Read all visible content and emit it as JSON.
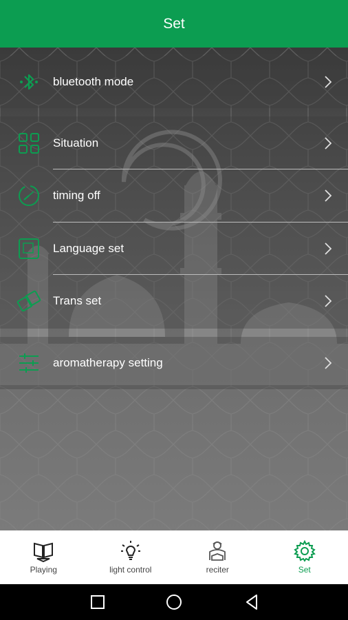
{
  "header": {
    "title": "Set"
  },
  "settings": {
    "items": [
      {
        "label": "bluetooth mode",
        "icon": "bluetooth-icon"
      },
      {
        "label": "Situation",
        "icon": "grid-icon"
      },
      {
        "label": "timing off",
        "icon": "timer-icon"
      },
      {
        "label": "Language set",
        "icon": "language-icon"
      },
      {
        "label": "Trans set",
        "icon": "transfer-icon"
      },
      {
        "label": "aromatherapy setting",
        "icon": "sliders-icon"
      }
    ]
  },
  "tabbar": {
    "tabs": [
      {
        "label": "Playing",
        "icon": "quran-book-icon",
        "active": false
      },
      {
        "label": "light control",
        "icon": "light-bulb-icon",
        "active": false
      },
      {
        "label": "reciter",
        "icon": "reciter-icon",
        "active": false
      },
      {
        "label": "Set",
        "icon": "gear-icon",
        "active": true
      }
    ]
  },
  "colors": {
    "accent": "#0c9d51",
    "header_bg": "#0c9d51",
    "row_text": "#ffffff"
  }
}
